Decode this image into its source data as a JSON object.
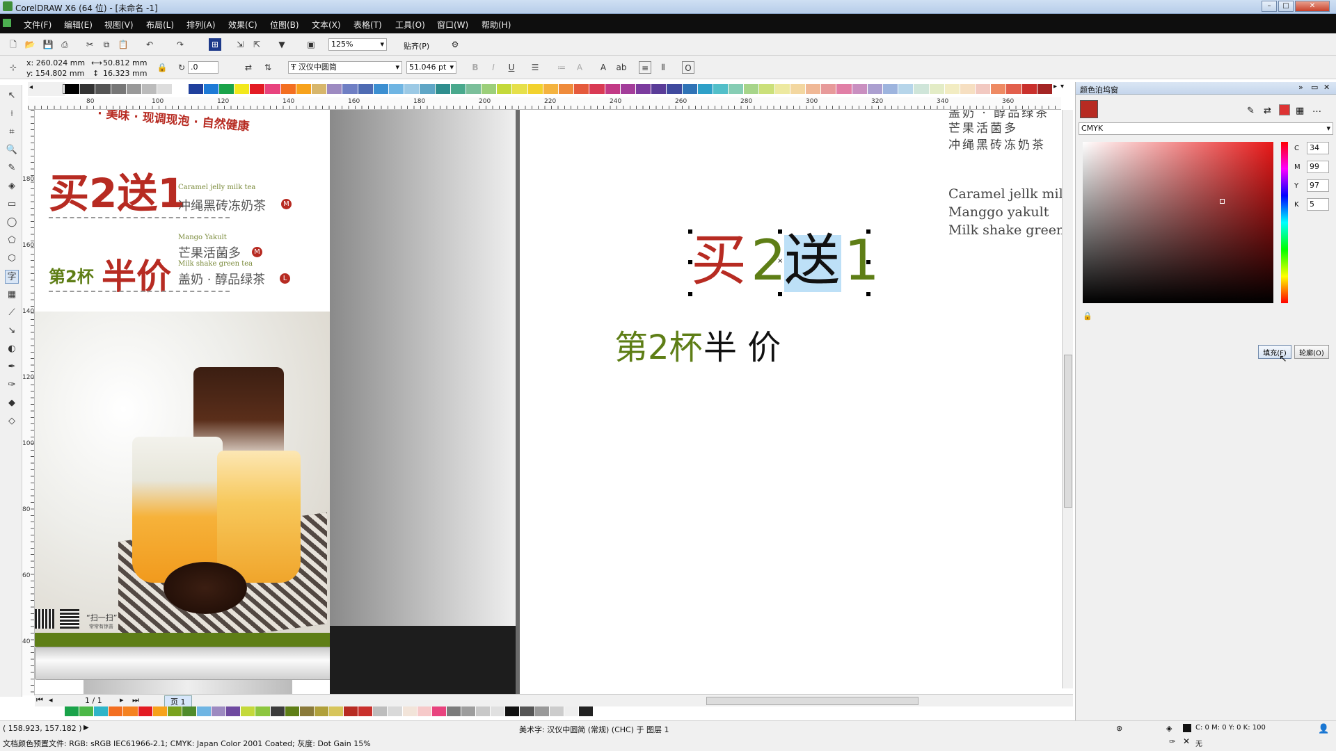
{
  "window": {
    "title": "CorelDRAW X6 (64 位) - [未命名 -1]"
  },
  "menu": [
    "文件(F)",
    "编辑(E)",
    "视图(V)",
    "布局(L)",
    "排列(A)",
    "效果(C)",
    "位图(B)",
    "文本(X)",
    "表格(T)",
    "工具(O)",
    "窗口(W)",
    "帮助(H)"
  ],
  "toolbar": {
    "zoom": "125%",
    "snap": "贴齐(P)"
  },
  "props": {
    "x": "x: 260.024 mm",
    "y": "y: 154.802 mm",
    "w": "50.812 mm",
    "h": "16.323 mm",
    "angle": ".0",
    "font": "汉仪中圆简",
    "size": "51.046 pt"
  },
  "ruler": {
    "h": [
      "80",
      "100",
      "120",
      "140",
      "160",
      "180",
      "200",
      "220",
      "240",
      "260",
      "280",
      "300",
      "320",
      "340",
      "360"
    ],
    "v": [
      "200",
      "180",
      "160",
      "140",
      "120",
      "100",
      "80",
      "60",
      "40"
    ]
  },
  "poster": {
    "top_text": "· 美味 · 现调现泡 · 自然健康",
    "buy2": "买2送1",
    "item1_en": "Caramel jelly milk tea",
    "item1_cn": "冲绳黑砖冻奶茶",
    "badge_m": "M",
    "badge_l": "L",
    "half_prefix": "第2杯",
    "half_big": "半价",
    "item2_en": "Mango Yakult",
    "item2_cn": "芒果活菌多",
    "item3_en": "Milk shake green tea",
    "item3_cn": "盖奶 · 醇品绿茶",
    "qr_text": "“扫一扫”",
    "qr_sub": "常常有惊喜"
  },
  "page": {
    "cn_line0": "盖奶 · 醇品绿茶",
    "cn_line1": "芒果活菌多",
    "cn_line2": "冲绳黑砖冻奶茶",
    "en_line1": "Caramel jellk milk tea",
    "en_line2": "Manggo yakult",
    "en_line3": "Milk shake green tea",
    "sel_a": "买",
    "sel_b": "2",
    "sel_c": "送",
    "sel_d": "1",
    "sub_a": "第2杯",
    "sub_b": "半 价"
  },
  "docker": {
    "title": "颜色泊坞窗",
    "model": "CMYK",
    "c_label": "C",
    "c": "34",
    "m_label": "M",
    "m": "99",
    "y_label": "Y",
    "y": "97",
    "k_label": "K",
    "k": "5",
    "fill": "填充(F)",
    "outline": "轮廓(O)"
  },
  "pager": {
    "page": "1 / 1",
    "tab": "页 1"
  },
  "status": {
    "coords": "( 158.923, 157.182 )",
    "info": "美术字: 汉仪中圆简 (常规) (CHC) 于 图层 1",
    "profile": "文档颜色预置文件: RGB: sRGB IEC61966-2.1; CMYK: Japan Color 2001 Coated; 灰度: Dot Gain 15%",
    "fill_info": "C: 0 M: 0 Y: 0 K: 100",
    "outline_info": "无"
  },
  "colors": {
    "red": "#b72b22",
    "green": "#5e7e16",
    "accent": "#c0302a"
  }
}
